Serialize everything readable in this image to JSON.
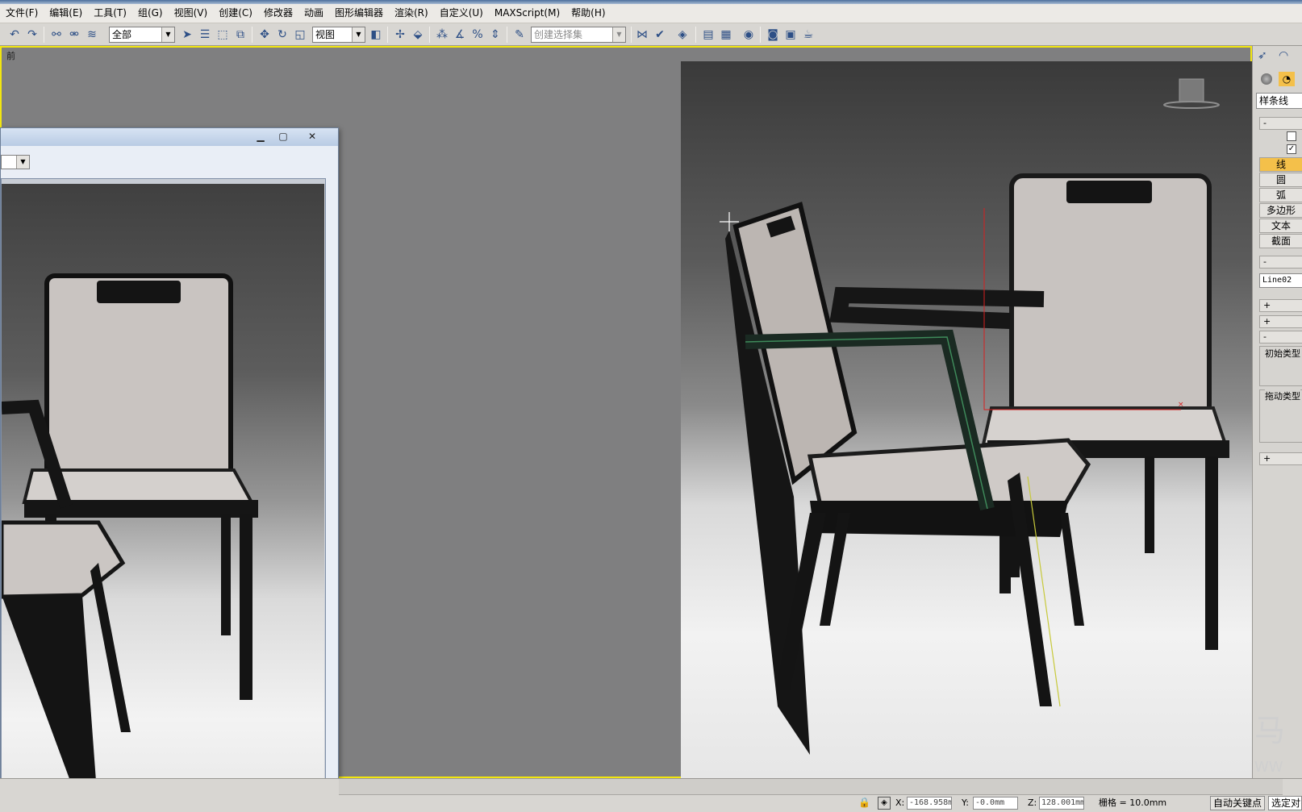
{
  "menu": [
    "文件(F)",
    "编辑(E)",
    "工具(T)",
    "组(G)",
    "视图(V)",
    "创建(C)",
    "修改器",
    "动画",
    "图形编辑器",
    "渲染(R)",
    "自定义(U)",
    "MAXScript(M)",
    "帮助(H)"
  ],
  "toolbar": {
    "selection_filter": "全部",
    "coord_system": "视图",
    "named_selection_placeholder": "创建选择集",
    "icons": [
      "undo-icon",
      "redo-icon",
      "select-link-icon",
      "unlink-icon",
      "bind-space-warp-icon",
      "select-object-icon",
      "select-by-name-icon",
      "rect-region-icon",
      "window-crossing-icon",
      "move-icon",
      "rotate-icon",
      "scale-icon",
      "pivot-icon",
      "snap-icon",
      "angle-snap-icon",
      "percent-snap-icon",
      "spinner-snap-icon",
      "edit-named-sel-icon",
      "mirror-icon",
      "align-icon",
      "layer-icon",
      "curve-editor-icon",
      "schematic-icon",
      "material-editor-icon",
      "render-setup-icon",
      "render-frame-icon",
      "quick-render-icon"
    ]
  },
  "viewport": {
    "label": "前",
    "border_color": "#f2e60f",
    "bg_color": "#7f7f80"
  },
  "viewer_window": {
    "buttons": [
      "minimize-icon",
      "maximize-icon",
      "close-icon"
    ]
  },
  "command_panel": {
    "category": "样条线",
    "object_types": [
      "线",
      "圆",
      "弧",
      "多边形",
      "文本",
      "截面"
    ],
    "active_type": "线",
    "name_field": "Line02",
    "creation_method_initial": "初始类型",
    "creation_method_drag": "拖动类型"
  },
  "statusbar": {
    "x_label": "X:",
    "x_value": "-168.958mm",
    "y_label": "Y:",
    "y_value": "-0.0mm",
    "z_label": "Z:",
    "z_value": "128.001mm",
    "grid": "栅格 = 10.0mm",
    "auto_key": "自动关键点",
    "selected": "选定对象"
  }
}
